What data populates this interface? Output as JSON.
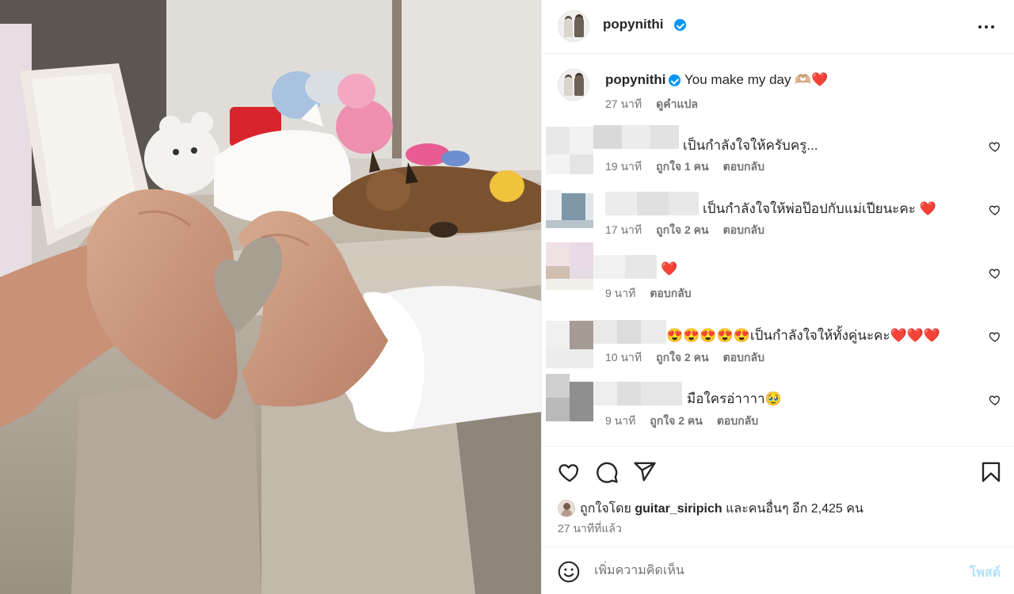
{
  "post": {
    "username": "popynithi",
    "caption": "You make my day 🫶🏼❤️",
    "caption_time": "27 นาที",
    "translate_label": "ดูคำแปล"
  },
  "comments": [
    {
      "text": "เป็นกำลังใจให้ครับครู...",
      "time": "19 นาที",
      "likes": "ถูกใจ 1 คน",
      "reply": "ตอบกลับ"
    },
    {
      "text": "เป็นกำลังใจให้พ่อป๊อปกับแม่เปียนะคะ ❤️",
      "time": "17 นาที",
      "likes": "ถูกใจ 2 คน",
      "reply": "ตอบกลับ"
    },
    {
      "text": "❤️",
      "time": "9 นาที",
      "likes": "",
      "reply": "ตอบกลับ"
    },
    {
      "text": "😍😍😍😍😍เป็นกำลังใจให้ทั้งคู่นะคะ❤️❤️❤️",
      "time": "10 นาที",
      "likes": "ถูกใจ 2 คน",
      "reply": "ตอบกลับ"
    },
    {
      "text": "มือใครอ่าาาา🥹",
      "time": "9 นาที",
      "likes": "ถูกใจ 2 คน",
      "reply": "ตอบกลับ"
    }
  ],
  "likes": {
    "prefix": "ถูกใจโดย ",
    "user": "guitar_siripich",
    "suffix": " และคนอื่นๆ อีก 2,425 คน",
    "time_ago": "27 นาทีที่แล้ว"
  },
  "composer": {
    "placeholder": "เพิ่มความคิดเห็น",
    "post_label": "โพสต์"
  },
  "icons": [
    "more-options-icon",
    "verified-badge-icon",
    "heart-icon",
    "comment-icon",
    "share-icon",
    "bookmark-icon",
    "emoji-icon"
  ],
  "colors": {
    "accent": "#0095f6",
    "post_disabled": "#b2dffc",
    "like_red": "#ed4956",
    "muted": "#737373"
  }
}
